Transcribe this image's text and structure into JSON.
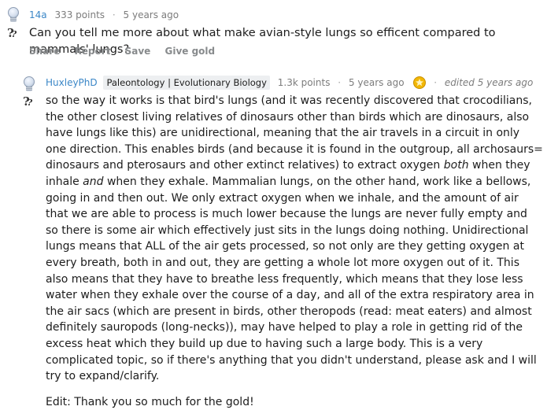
{
  "comment1": {
    "author": "14a",
    "points": "333 points",
    "time": "5 years ago",
    "body": "Can you tell me more about what make avian-style lungs so efficent compared to mammals' lungs?",
    "actions": [
      "Share",
      "Report",
      "Save",
      "Give gold"
    ]
  },
  "comment2": {
    "author": "HuxleyPhD",
    "flair": "Paleontology | Evolutionary Biology",
    "points": "1.3k points",
    "time": "5 years ago",
    "edited": "edited 5 years ago",
    "body_parts": [
      "so the way it works is that bird's lungs (and it was recently discovered that crocodilians, the other closest living relatives of dinosaurs other than birds which are dinosaurs, also have lungs like this) are unidirectional, meaning that the air travels in a circuit in only one direction. This enables birds (and because it is found in the outgroup, all archosaurs= dinosaurs and pterosaurs and other extinct relatives) to extract oxygen ",
      "both",
      " when they inhale ",
      "and",
      " when they exhale. Mammalian lungs, on the other hand, work like a bellows, going in and then out. We only extract oxygen when we inhale, and the amount of air that we are able to process is much lower because the lungs are never fully empty and so there is some air which effectively just sits in the lungs doing nothing. Unidirectional lungs means that ALL of the air gets processed, so not only are they getting oxygen at every breath, both in and out, they are getting a whole lot more oxygen out of it. This also means that they have to breathe less frequently, which means that they lose less water when they exhale over the course of a day, and all of the extra respiratory area in the air sacs (which are present in birds, other theropods (read: meat eaters) and almost definitely sauropods (long-necks)), may have helped to play a role in getting rid of the excess heat which they build up due to having such a large body. This is a very complicated topic, so if there's anything that you didn't understand, please ask and I will try to expand/clarify."
    ],
    "edit_note": "Edit: Thank you so much for the gold!"
  },
  "colors": {
    "author": "#3b87c7",
    "gold": "#f2b705",
    "meta": "#7c7c7c"
  }
}
